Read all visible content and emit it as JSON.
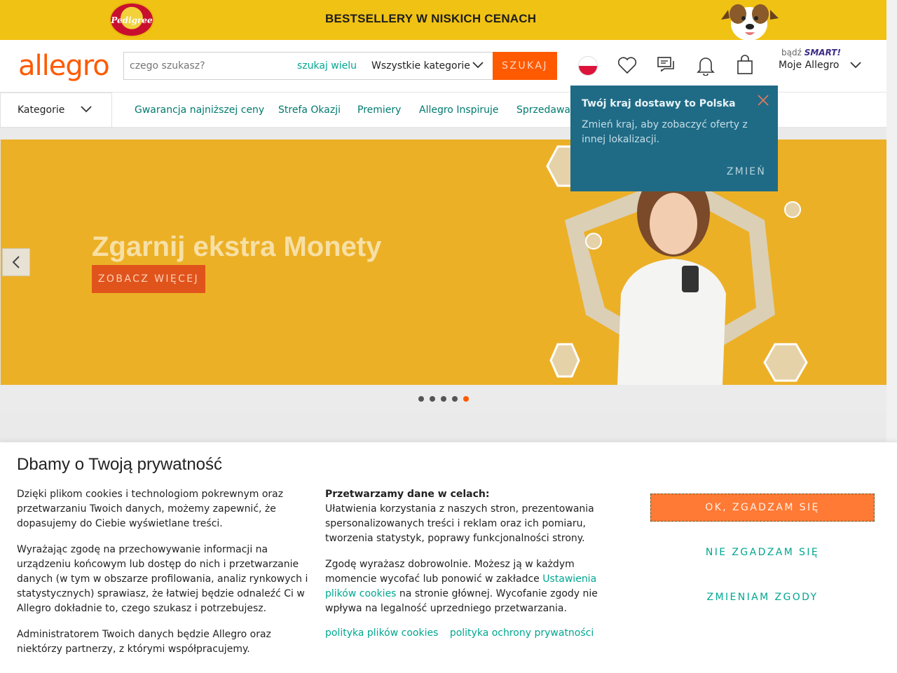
{
  "promo": {
    "brand": "Pedigree",
    "text": "BESTSELLERY W NISKICH CENACH"
  },
  "header": {
    "logo": "allegro",
    "search_placeholder": "czego szukasz?",
    "search_many": "szukaj wielu",
    "category": "Wszystkie kategorie",
    "search_button": "SZUKAJ",
    "smart_prefix": "bądź",
    "smart_label": "SMART!",
    "account": "Moje Allegro"
  },
  "nav": {
    "categories": "Kategorie",
    "links": [
      "Gwarancja najniższej ceny",
      "Strefa Okazji",
      "Premiery",
      "Allegro Inspiruje",
      "Sprzedawaj"
    ]
  },
  "tooltip": {
    "title": "Twój kraj dostawy to Polska",
    "desc": "Zmień kraj, aby zobaczyć oferty z innej lokalizacji.",
    "button": "ZMIEŃ"
  },
  "hero": {
    "title": "Zgarnij ekstra Monety",
    "cta": "ZOBACZ WIĘCEJ",
    "slides": 5,
    "active_slide": 5
  },
  "cookie": {
    "title": "Dbamy o Twoją prywatność",
    "col1": [
      "Dzięki plikom cookies i technologiom pokrewnym oraz przetwarzaniu Twoich danych, możemy zapewnić, że dopasujemy do Ciebie wyświetlane treści.",
      "Wyrażając zgodę na przechowywanie informacji na urządzeniu końcowym lub dostęp do nich i przetwarzanie danych (w tym w obszarze profilowania, analiz rynkowych i statystycznych) sprawiasz, że łatwiej będzie odnaleźć Ci w Allegro dokładnie to, czego szukasz i potrzebujesz.",
      "Administratorem Twoich danych będzie Allegro oraz niektórzy partnerzy, z którymi współpracujemy."
    ],
    "col2_head": "Przetwarzamy dane w celach:",
    "col2_body": "Ułatwienia korzystania z naszych stron, prezentowania spersonalizowanych treści i reklam oraz ich pomiaru, tworzenia statystyk, poprawy funkcjonalności strony.",
    "col2_p2_before": "Zgodę wyrażasz dobrowolnie. Możesz ją w każdym momencie wycofać lub ponowić w zakładce ",
    "col2_p2_link": "Ustawienia plików cookies",
    "col2_p2_after": " na stronie głównej. Wycofanie zgody nie wpływa na legalność uprzedniego przetwarzania.",
    "link_cookies": "polityka plików cookies",
    "link_privacy": "polityka ochrony prywatności",
    "btn_ok": "OK, ZGADZAM SIĘ",
    "btn_no": "NIE ZGADZAM SIĘ",
    "btn_change": "ZMIENIAM ZGODY"
  }
}
